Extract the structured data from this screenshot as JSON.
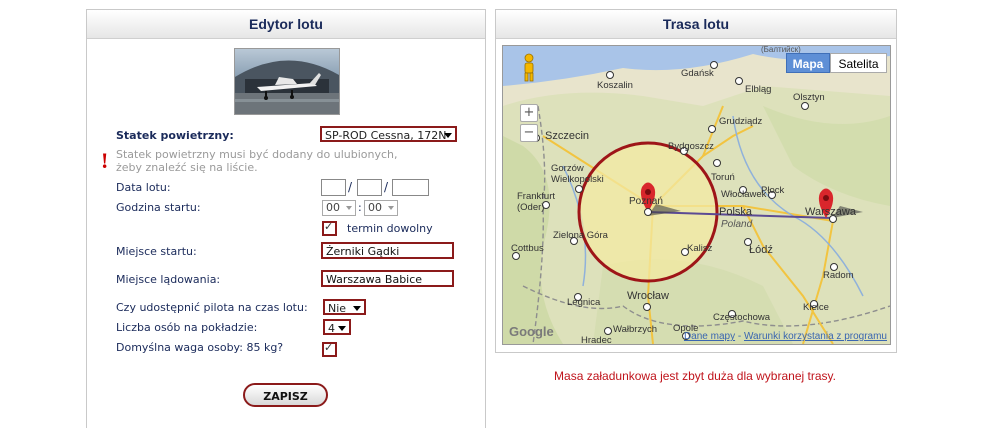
{
  "editor": {
    "title": "Edytor lotu",
    "aircraft_label": "Statek powietrzny:",
    "aircraft_value": "SP-ROD Cessna, 172N",
    "aircraft_warning_line1": "Statek powietrzny musi być dodany do ulubionych,",
    "aircraft_warning_line2": "żeby znaleźć się na liście.",
    "warning_mark": "!",
    "date_label": "Data lotu:",
    "date_sep1": "/",
    "date_sep2": "/",
    "time_label": "Godzina startu:",
    "hour_value": "00",
    "minute_value": "00",
    "time_sep": ":",
    "flexible_label": "termin dowolny",
    "start_label": "Miejsce startu:",
    "start_value": "Żerniki Gądki",
    "landing_label": "Miejsce lądowania:",
    "landing_value": "Warszawa Babice",
    "share_pilot_label": "Czy udostępnić pilota na czas lotu:",
    "share_pilot_value": "Nie",
    "persons_label": "Liczba osób na pokładzie:",
    "persons_value": "4",
    "default_weight_label": "Domyślna waga osoby: 85 kg?",
    "save_label": "ZAPISZ"
  },
  "route": {
    "title": "Trasa lotu",
    "map_type_map": "Mapa",
    "map_type_satellite": "Satelita",
    "zoom_in": "+",
    "zoom_out": "−",
    "map_data_link": "Dane mapy",
    "link_sep": " - ",
    "terms_link": "Warunki korzystania z programu",
    "google_logo": "Google",
    "cities": {
      "baltic": "(Балтийск)",
      "gdansk": "Gdańsk",
      "koszalin": "Koszalin",
      "elblag": "Elbląg",
      "olsztyn": "Olsztyn",
      "szczecin": "Szczecin",
      "grudziadz": "Grudziądz",
      "bydgoszcz": "Bydgoszcz",
      "gorzow": "Gorzów Wielkopolski",
      "torun": "Toruń",
      "wloclawek": "Włocławek",
      "plock": "Płock",
      "frankfurt": "Frankfurt (Oder)",
      "poznan": "Poznań",
      "polska": "Polska",
      "poland": "Poland",
      "warszawa": "Warszawa",
      "zielona_gora": "Zielona Góra",
      "kalisz": "Kalisz",
      "lodz": "Łódź",
      "cottbus": "Cottbus",
      "radom": "Radom",
      "legnica": "Legnica",
      "wroclaw": "Wrocław",
      "kielce": "Kielce",
      "czestochowa": "Częstochowa",
      "opole": "Opole",
      "walbrzych": "Wałbrzych",
      "hradec": "Hradec"
    }
  },
  "error_message": "Masa załadunkowa jest zbyt duża dla wybranej trasy."
}
